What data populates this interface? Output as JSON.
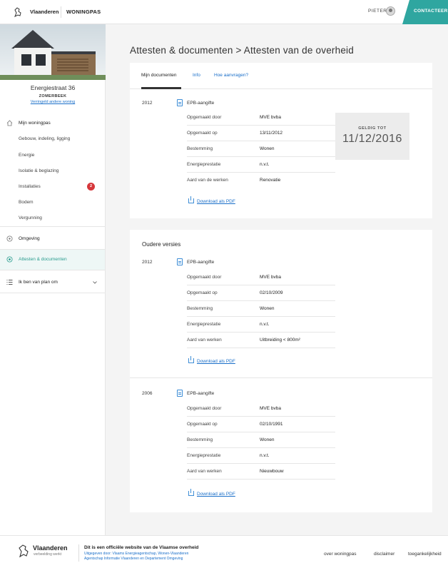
{
  "header": {
    "brand": "Vlaanderen",
    "product": "WONINGPAS",
    "user": "PIETER",
    "cta": "CONTACTEER ONS"
  },
  "sidebar": {
    "address": {
      "street": "Energiestraat 36",
      "city": "ZOMERBEEK",
      "link": "Verringeld andere woning"
    },
    "section_woningpas": "Mijn woningpas",
    "items": [
      {
        "label": "Gebouw, indeling, ligging"
      },
      {
        "label": "Energie"
      },
      {
        "label": "Isolatie & beglazing"
      },
      {
        "label": "Installaties",
        "badge": "2"
      },
      {
        "label": "Bodem"
      },
      {
        "label": "Vergunning"
      }
    ],
    "omgeving": "Omgeving",
    "attesten": "Attesten & documenten",
    "plan": "Ik ben van plan om"
  },
  "main": {
    "breadcrumb": "Attesten & documenten  >  Attesten van de overheid",
    "tabs": [
      {
        "label": "Mijn documenten"
      },
      {
        "label": "Info"
      },
      {
        "label": "Hoe aanvragen?"
      }
    ],
    "current": {
      "year": "2012",
      "doc_title": "EPB-aangifte",
      "rows": [
        {
          "k": "Opgemaakt door",
          "v": "MVE bvba"
        },
        {
          "k": "Opgemaakt op",
          "v": "13/11/2012"
        },
        {
          "k": "Bestemming",
          "v": "Wonen"
        },
        {
          "k": "Energieprestatie",
          "v": "n.v.t."
        },
        {
          "k": "Aard van de werken",
          "v": "Renovatie"
        }
      ],
      "download": "Download als PDF",
      "valid_label": "GELDIG TOT",
      "valid_date": "11/12/2016"
    },
    "older_title": "Oudere versies",
    "older": [
      {
        "year": "2012",
        "doc_title": "EPB-aangifte",
        "rows": [
          {
            "k": "Opgemaakt door",
            "v": "MVE bvba"
          },
          {
            "k": "Opgemaakt op",
            "v": "02/10/2009"
          },
          {
            "k": "Bestemming",
            "v": "Wonen"
          },
          {
            "k": "Energieprestatie",
            "v": "n.v.t."
          },
          {
            "k": "Aard van werken",
            "v": "Uitbreiding < 800m²"
          }
        ],
        "download": "Download als PDF"
      },
      {
        "year": "2006",
        "doc_title": "EPB-aangifte",
        "rows": [
          {
            "k": "Opgemaakt door",
            "v": "MVE bvba"
          },
          {
            "k": "Opgemaakt op",
            "v": "02/10/1991"
          },
          {
            "k": "Bestemming",
            "v": "Wonen"
          },
          {
            "k": "Energieprestatie",
            "v": "n.v.t."
          },
          {
            "k": "Aard van werken",
            "v": "Nieuwbouw"
          }
        ],
        "download": "Download als PDF"
      }
    ]
  },
  "footer": {
    "brand": "Vlaanderen",
    "tagline": "verbeelding werkt",
    "title": "Dit is een officiële website van de Vlaamse overheid",
    "line1": "Uitgegeven door: Vlaams Energieagentschap, Wonen-Vlaanderen",
    "line2": "Agentschap Informatie Vlaanderen en Departement Omgeving",
    "links": [
      "over woningpas",
      "disclaimer",
      "toegankelijkheid"
    ]
  }
}
